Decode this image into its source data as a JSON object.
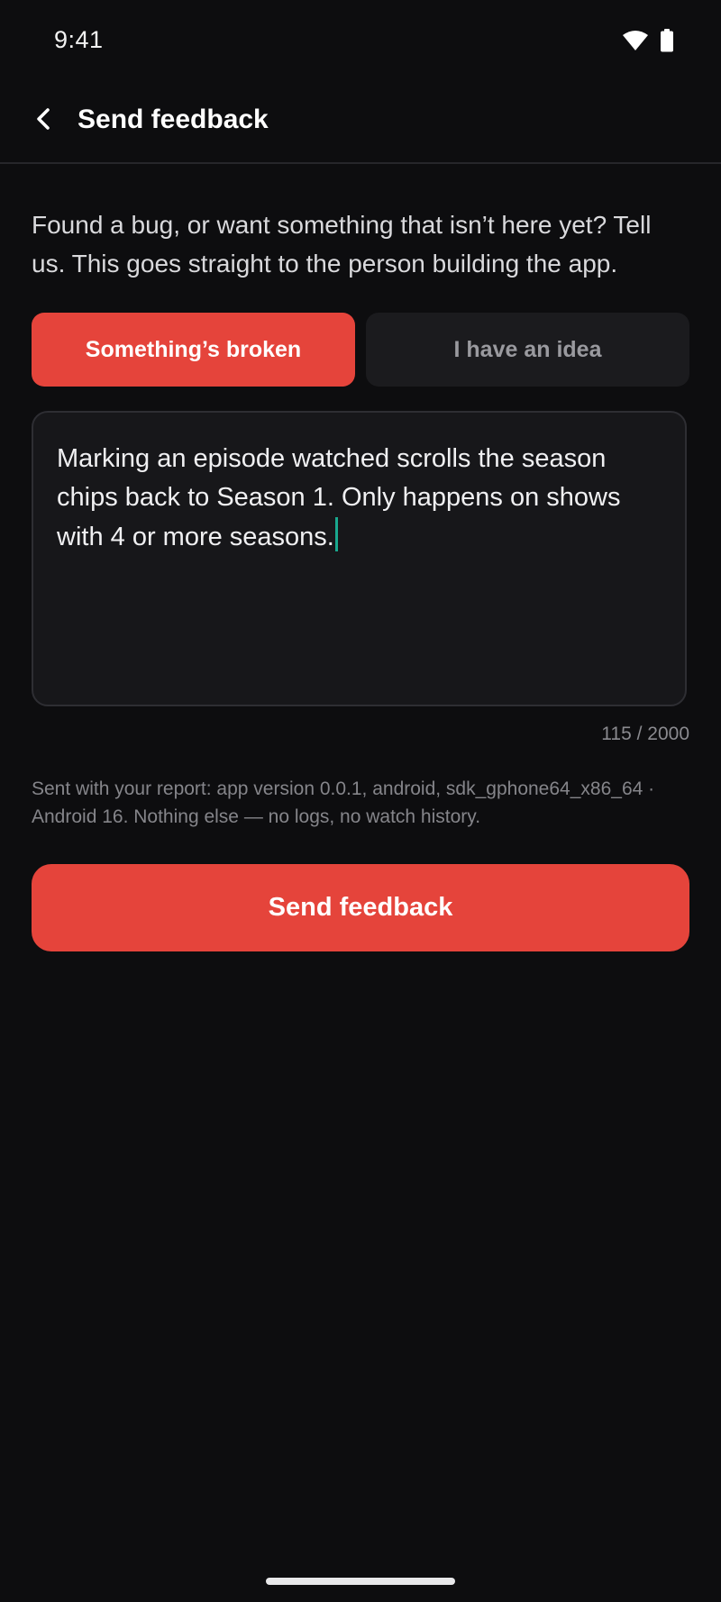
{
  "status_bar": {
    "time": "9:41",
    "icons": [
      "wifi-icon",
      "battery-icon"
    ]
  },
  "app_bar": {
    "back_icon": "chevron-left-icon",
    "title": "Send feedback"
  },
  "intro": "Found a bug, or want something that isn’t here yet? Tell us. This goes straight to the person building the app.",
  "feedback_type": {
    "options": [
      {
        "label": "Something’s broken",
        "selected": true
      },
      {
        "label": "I have an idea",
        "selected": false
      }
    ]
  },
  "message": {
    "value": "Marking an episode watched scrolls the season chips back to Season 1. Only happens on shows with 4 or more seasons.",
    "counter": "115 / 2000"
  },
  "meta_note": "Sent with your report: app version 0.0.1, android, sdk_gphone64_x86_64 · Android 16. Nothing else — no logs, no watch history.",
  "submit": {
    "label": "Send feedback"
  },
  "colors": {
    "background": "#0d0d0f",
    "accent": "#e5443b",
    "caret": "#19a88e",
    "surface": "#17171a"
  }
}
